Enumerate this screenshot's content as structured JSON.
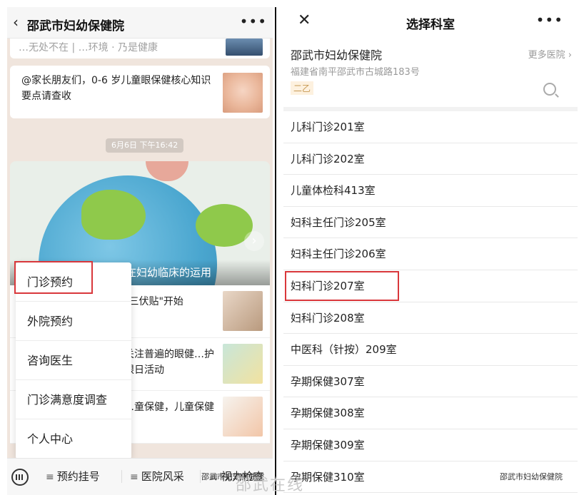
{
  "left": {
    "header": {
      "title": "邵武市妇幼保健院",
      "back_icon": "chevron-left-icon",
      "more_icon": "more-dots-icon"
    },
    "card1_text": "…无处不在 | …环境 · 乃是健康",
    "card2_text": "@家长朋友们，0-6 岁儿童眼保健核心知识要点请查收",
    "timestamp": "6月6日 下午16:42",
    "banner_caption": "【妇幼中医】中医中药在妇幼临床的运用",
    "list": [
      {
        "text": "\"三伏贴\"开始"
      },
      {
        "text": "关注普遍的眼健…护眼日活动"
      },
      {
        "text": "…童保健，儿童保健"
      }
    ],
    "popup": [
      "门诊预约",
      "外院预约",
      "咨询医生",
      "门诊满意度调查",
      "个人中心"
    ],
    "tabbar": {
      "tabs": [
        "预约挂号",
        "医院风采",
        "视力检查"
      ]
    }
  },
  "right": {
    "header": {
      "title": "选择科室",
      "close_icon": "close-icon",
      "more_icon": "more-dots-icon"
    },
    "hospital": {
      "name": "邵武市妇幼保健院",
      "more_link": "更多医院",
      "address": "福建省南平邵武市古城路183号",
      "tag": "二乙"
    },
    "departments": [
      "儿科门诊201室",
      "儿科门诊202室",
      "儿童体检科413室",
      "妇科主任门诊205室",
      "妇科主任门诊206室",
      "妇科门诊207室",
      "妇科门诊208室",
      "中医科（针按）209室",
      "孕期保健307室",
      "孕期保健308室",
      "孕期保健309室",
      "孕期保健310室"
    ]
  },
  "watermarks": {
    "left": "邵武市妇幼保健院",
    "right": "邵武市妇幼保健院",
    "center": "邵武在线"
  },
  "colors": {
    "highlight": "#d9373b",
    "tag_bg": "#fdf1df",
    "tag_text": "#c79a55"
  }
}
